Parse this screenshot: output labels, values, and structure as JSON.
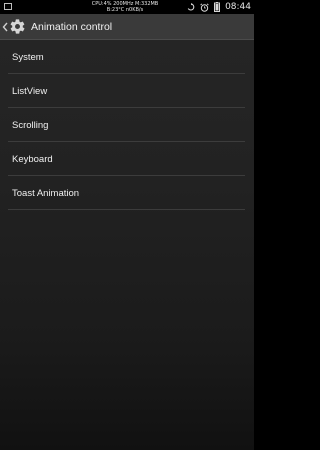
{
  "status_bar": {
    "line1": "CPU:4% 200MHz M:332MB",
    "line2": "B:23°C n0KB/s",
    "time": "08:44",
    "icons": [
      "notification-icon",
      "rotate-icon",
      "alarm-icon",
      "battery-icon"
    ]
  },
  "action_bar": {
    "title": "Animation control",
    "icons": [
      "chevron-left-icon",
      "gear-icon"
    ]
  },
  "list": {
    "items": [
      {
        "label": "System"
      },
      {
        "label": "ListView"
      },
      {
        "label": "Scrolling"
      },
      {
        "label": "Keyboard"
      },
      {
        "label": "Toast Animation"
      }
    ]
  },
  "colors": {
    "action_bar_bg": "#3a3a3a",
    "background": "#222222",
    "text": "#f0f0f0",
    "divider": "#3c3c3c"
  }
}
